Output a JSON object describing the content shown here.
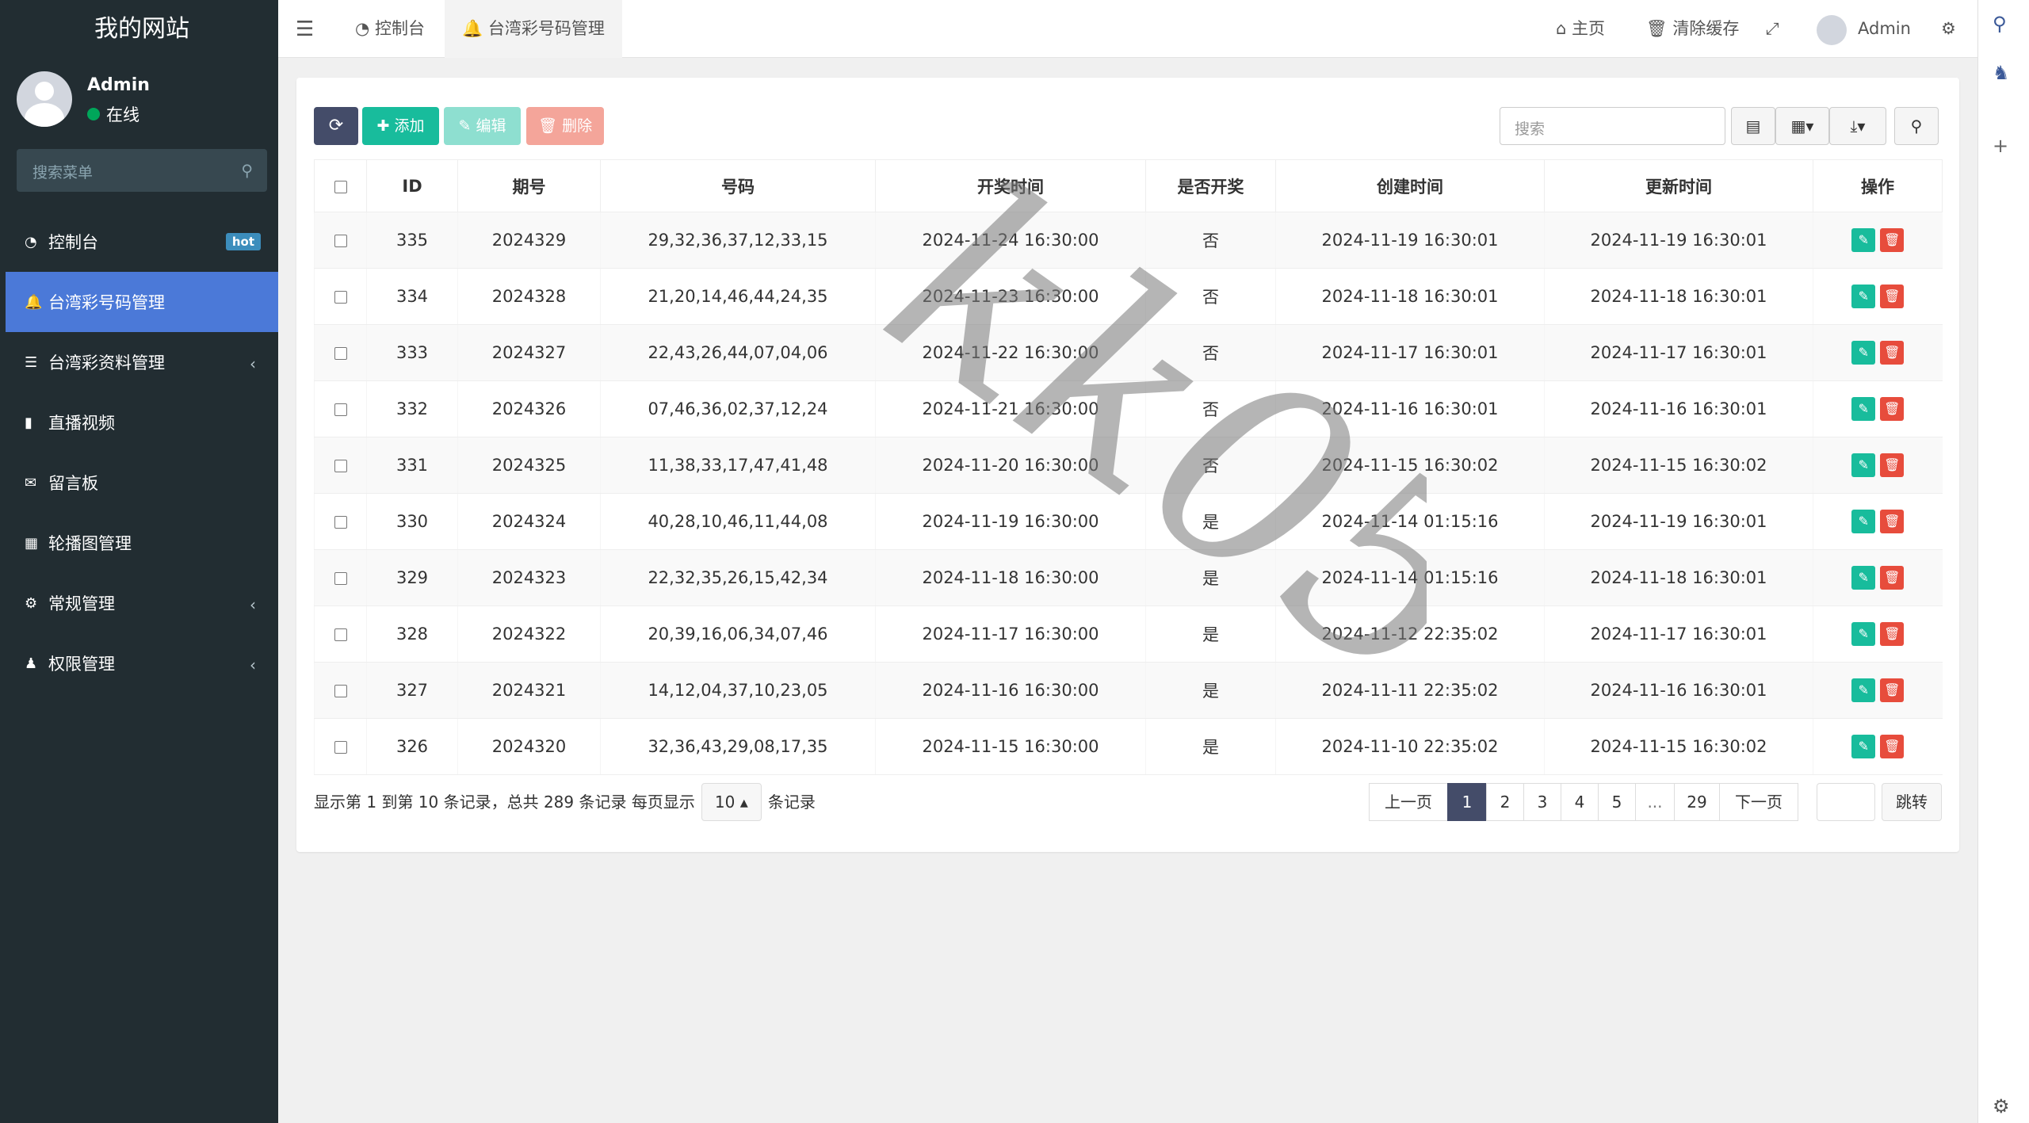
{
  "site": {
    "title": "我的网站"
  },
  "user": {
    "name": "Admin",
    "status": "在线"
  },
  "sidebar": {
    "search_placeholder": "搜索菜单",
    "items": [
      {
        "label": "控制台",
        "badge": "hot",
        "icon": "dashboard-icon"
      },
      {
        "label": "台湾彩号码管理",
        "icon": "bell-icon",
        "active": true
      },
      {
        "label": "台湾彩资料管理",
        "icon": "list-icon",
        "chevron": "‹"
      },
      {
        "label": "直播视频",
        "icon": "video-icon"
      },
      {
        "label": "留言板",
        "icon": "comment-icon"
      },
      {
        "label": "轮播图管理",
        "icon": "image-icon"
      },
      {
        "label": "常规管理",
        "icon": "cogs-icon",
        "chevron": "‹"
      },
      {
        "label": "权限管理",
        "icon": "users-icon",
        "chevron": "‹"
      }
    ]
  },
  "topbar": {
    "tabs": [
      "控制台",
      "台湾彩号码管理"
    ],
    "home": "主页",
    "clear_cache": "清除缓存",
    "user": "Admin"
  },
  "toolbar": {
    "add": "添加",
    "edit": "编辑",
    "delete": "删除",
    "search_placeholder": "搜索"
  },
  "table": {
    "columns": [
      "ID",
      "期号",
      "号码",
      "开奖时间",
      "是否开奖",
      "创建时间",
      "更新时间",
      "操作"
    ],
    "rows": [
      [
        "335",
        "2024329",
        "29,32,36,37,12,33,15",
        "2024-11-24 16:30:00",
        "否",
        "2024-11-19 16:30:01",
        "2024-11-19 16:30:01"
      ],
      [
        "334",
        "2024328",
        "21,20,14,46,44,24,35",
        "2024-11-23 16:30:00",
        "否",
        "2024-11-18 16:30:01",
        "2024-11-18 16:30:01"
      ],
      [
        "333",
        "2024327",
        "22,43,26,44,07,04,06",
        "2024-11-22 16:30:00",
        "否",
        "2024-11-17 16:30:01",
        "2024-11-17 16:30:01"
      ],
      [
        "332",
        "2024326",
        "07,46,36,02,37,12,24",
        "2024-11-21 16:30:00",
        "否",
        "2024-11-16 16:30:01",
        "2024-11-16 16:30:01"
      ],
      [
        "331",
        "2024325",
        "11,38,33,17,47,41,48",
        "2024-11-20 16:30:00",
        "否",
        "2024-11-15 16:30:02",
        "2024-11-15 16:30:02"
      ],
      [
        "330",
        "2024324",
        "40,28,10,46,11,44,08",
        "2024-11-19 16:30:00",
        "是",
        "2024-11-14 01:15:16",
        "2024-11-19 16:30:01"
      ],
      [
        "329",
        "2024323",
        "22,32,35,26,15,42,34",
        "2024-11-18 16:30:00",
        "是",
        "2024-11-14 01:15:16",
        "2024-11-18 16:30:01"
      ],
      [
        "328",
        "2024322",
        "20,39,16,06,34,07,46",
        "2024-11-17 16:30:00",
        "是",
        "2024-11-12 22:35:02",
        "2024-11-17 16:30:01"
      ],
      [
        "327",
        "2024321",
        "14,12,04,37,10,23,05",
        "2024-11-16 16:30:00",
        "是",
        "2024-11-11 22:35:02",
        "2024-11-16 16:30:01"
      ],
      [
        "326",
        "2024320",
        "32,36,43,29,08,17,35",
        "2024-11-15 16:30:00",
        "是",
        "2024-11-10 22:35:02",
        "2024-11-15 16:30:02"
      ]
    ]
  },
  "pager": {
    "info": "显示第 1 到第 10 条记录，总共 289 条记录 每页显示",
    "page_size": "10",
    "suffix": "条记录",
    "prev": "上一页",
    "pages": [
      "1",
      "2",
      "3",
      "4",
      "5",
      "...",
      "29"
    ],
    "next": "下一页",
    "jump": "跳转"
  },
  "watermark": "kk058",
  "colors": {
    "sidebar": "#222d32",
    "active": "#4b79d8",
    "success": "#18bc9c",
    "danger": "#e74c3c",
    "primary": "#444c69"
  }
}
